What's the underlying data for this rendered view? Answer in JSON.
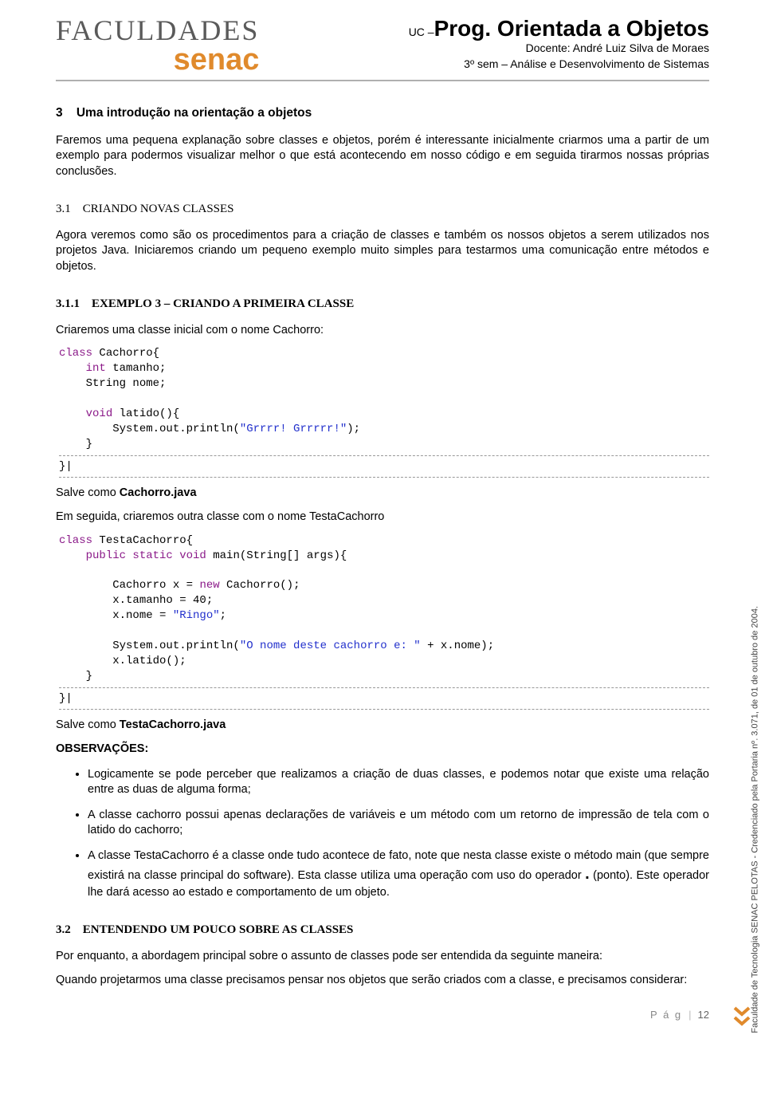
{
  "header": {
    "logo_top": "FACULDADES",
    "logo_bottom": "senac",
    "uc_prefix": "UC –",
    "uc_title": "Prog. Orientada a Objetos",
    "docente": "Docente: André Luiz Silva de Moraes",
    "sem": "3º sem – Análise e Desenvolvimento de Sistemas"
  },
  "sections": {
    "s3_num": "3",
    "s3_title": "Uma introdução na orientação a objetos",
    "s3_p1": "Faremos uma pequena explanação sobre classes e objetos, porém é interessante inicialmente criarmos uma a partir de um exemplo para podermos visualizar melhor o que está acontecendo em nosso código e em seguida tirarmos nossas próprias conclusões.",
    "s31_num": "3.1",
    "s31_title": "CRIANDO NOVAS CLASSES",
    "s31_p1": "Agora veremos como são os procedimentos para a criação de classes e também os nossos objetos a serem utilizados nos projetos Java. Iniciaremos criando um pequeno exemplo muito simples para testarmos uma comunicação entre métodos e objetos.",
    "s311_num": "3.1.1",
    "s311_title": "EXEMPLO 3 – CRIANDO A PRIMEIRA CLASSE",
    "s311_p1": "Criaremos uma classe inicial com o nome Cachorro:",
    "save1_a": "Salve como ",
    "save1_b": "Cachorro.java",
    "p_after1": "Em seguida, criaremos outra classe com o nome TestaCachorro",
    "save2_a": "Salve como ",
    "save2_b": "TestaCachorro.java",
    "obs_title": "OBSERVAÇÕES:",
    "obs1": "Logicamente se pode perceber que realizamos a criação de duas classes, e podemos notar que existe uma relação entre as duas de alguma forma;",
    "obs2": "A classe cachorro possui apenas declarações de variáveis e um método com um retorno de impressão de tela com o latido do cachorro;",
    "obs3_a": "A classe TestaCachorro é a classe onde tudo acontece de fato, note que nesta classe existe o método main (que sempre existirá na classe principal do software). Esta classe utiliza uma operação com uso do operador ",
    "obs3_dot": ".",
    "obs3_b": " (ponto). Este operador lhe dará acesso ao estado e comportamento de um objeto.",
    "s32_num": "3.2",
    "s32_title": "ENTENDENDO UM POUCO SOBRE AS CLASSES",
    "s32_p1": "Por enquanto, a abordagem principal sobre o assunto de classes pode ser entendida da seguinte maneira:",
    "s32_p2": "Quando projetarmos uma classe precisamos pensar nos objetos que serão criados com a classe, e precisamos considerar:"
  },
  "code1": {
    "l1a": "class",
    "l1b": " Cachorro{",
    "l2a": "int",
    "l2b": " tamanho;",
    "l3": "    String nome;",
    "l4": "",
    "l5a": "void",
    "l5b": " latido(){",
    "l6a": "        System.out.println(",
    "l6b": "\"Grrrr! Grrrrr!\"",
    "l6c": ");",
    "l7": "    }",
    "l8": "}|"
  },
  "code2": {
    "l1a": "class",
    "l1b": " TestaCachorro{",
    "l2a": "public static void",
    "l2b": " main(String[] args){",
    "l3": "",
    "l4a": "        Cachorro x = ",
    "l4b": "new",
    "l4c": " Cachorro();",
    "l5": "        x.tamanho = 40;",
    "l6a": "        x.nome = ",
    "l6b": "\"Ringo\"",
    "l6c": ";",
    "l7": "",
    "l8a": "        System.out.println(",
    "l8b": "\"O nome deste cachorro e: \"",
    "l8c": " + x.nome);",
    "l9": "        x.latido();",
    "l10": "    }",
    "l11": "}|"
  },
  "sidebar": "Faculdade de Tecnologia SENAC PELOTAS - Credenciado pela Portaria nº. 3.071, de 01 de outubro de 2004.",
  "footer": {
    "label": "P á g",
    "sep": "|",
    "num": "12"
  }
}
